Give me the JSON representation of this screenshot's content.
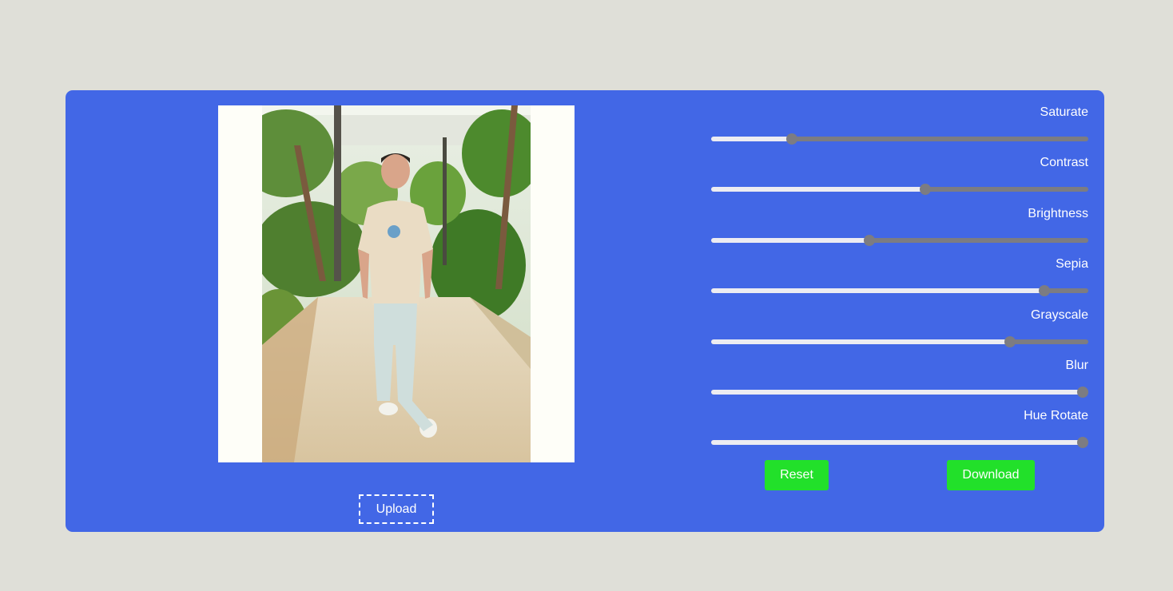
{
  "preview": {
    "alt": "Photo of a man in a beige t-shirt and light jeans standing on a paved path under trees"
  },
  "upload": {
    "label": "Upload"
  },
  "sliders": [
    {
      "label": "Saturate",
      "value": 0.215
    },
    {
      "label": "Contrast",
      "value": 0.567
    },
    {
      "label": "Brightness",
      "value": 0.42
    },
    {
      "label": "Sepia",
      "value": 0.883
    },
    {
      "label": "Grayscale",
      "value": 0.793
    },
    {
      "label": "Blur",
      "value": 0.985
    },
    {
      "label": "Hue Rotate",
      "value": 0.985
    }
  ],
  "actions": {
    "reset_label": "Reset",
    "download_label": "Download"
  },
  "colors": {
    "page_background": "#dfdfd8",
    "panel_background": "#4267e6",
    "button_green": "#22e02a",
    "slider_track": "#7c7c82",
    "slider_fill": "#ececf2"
  }
}
